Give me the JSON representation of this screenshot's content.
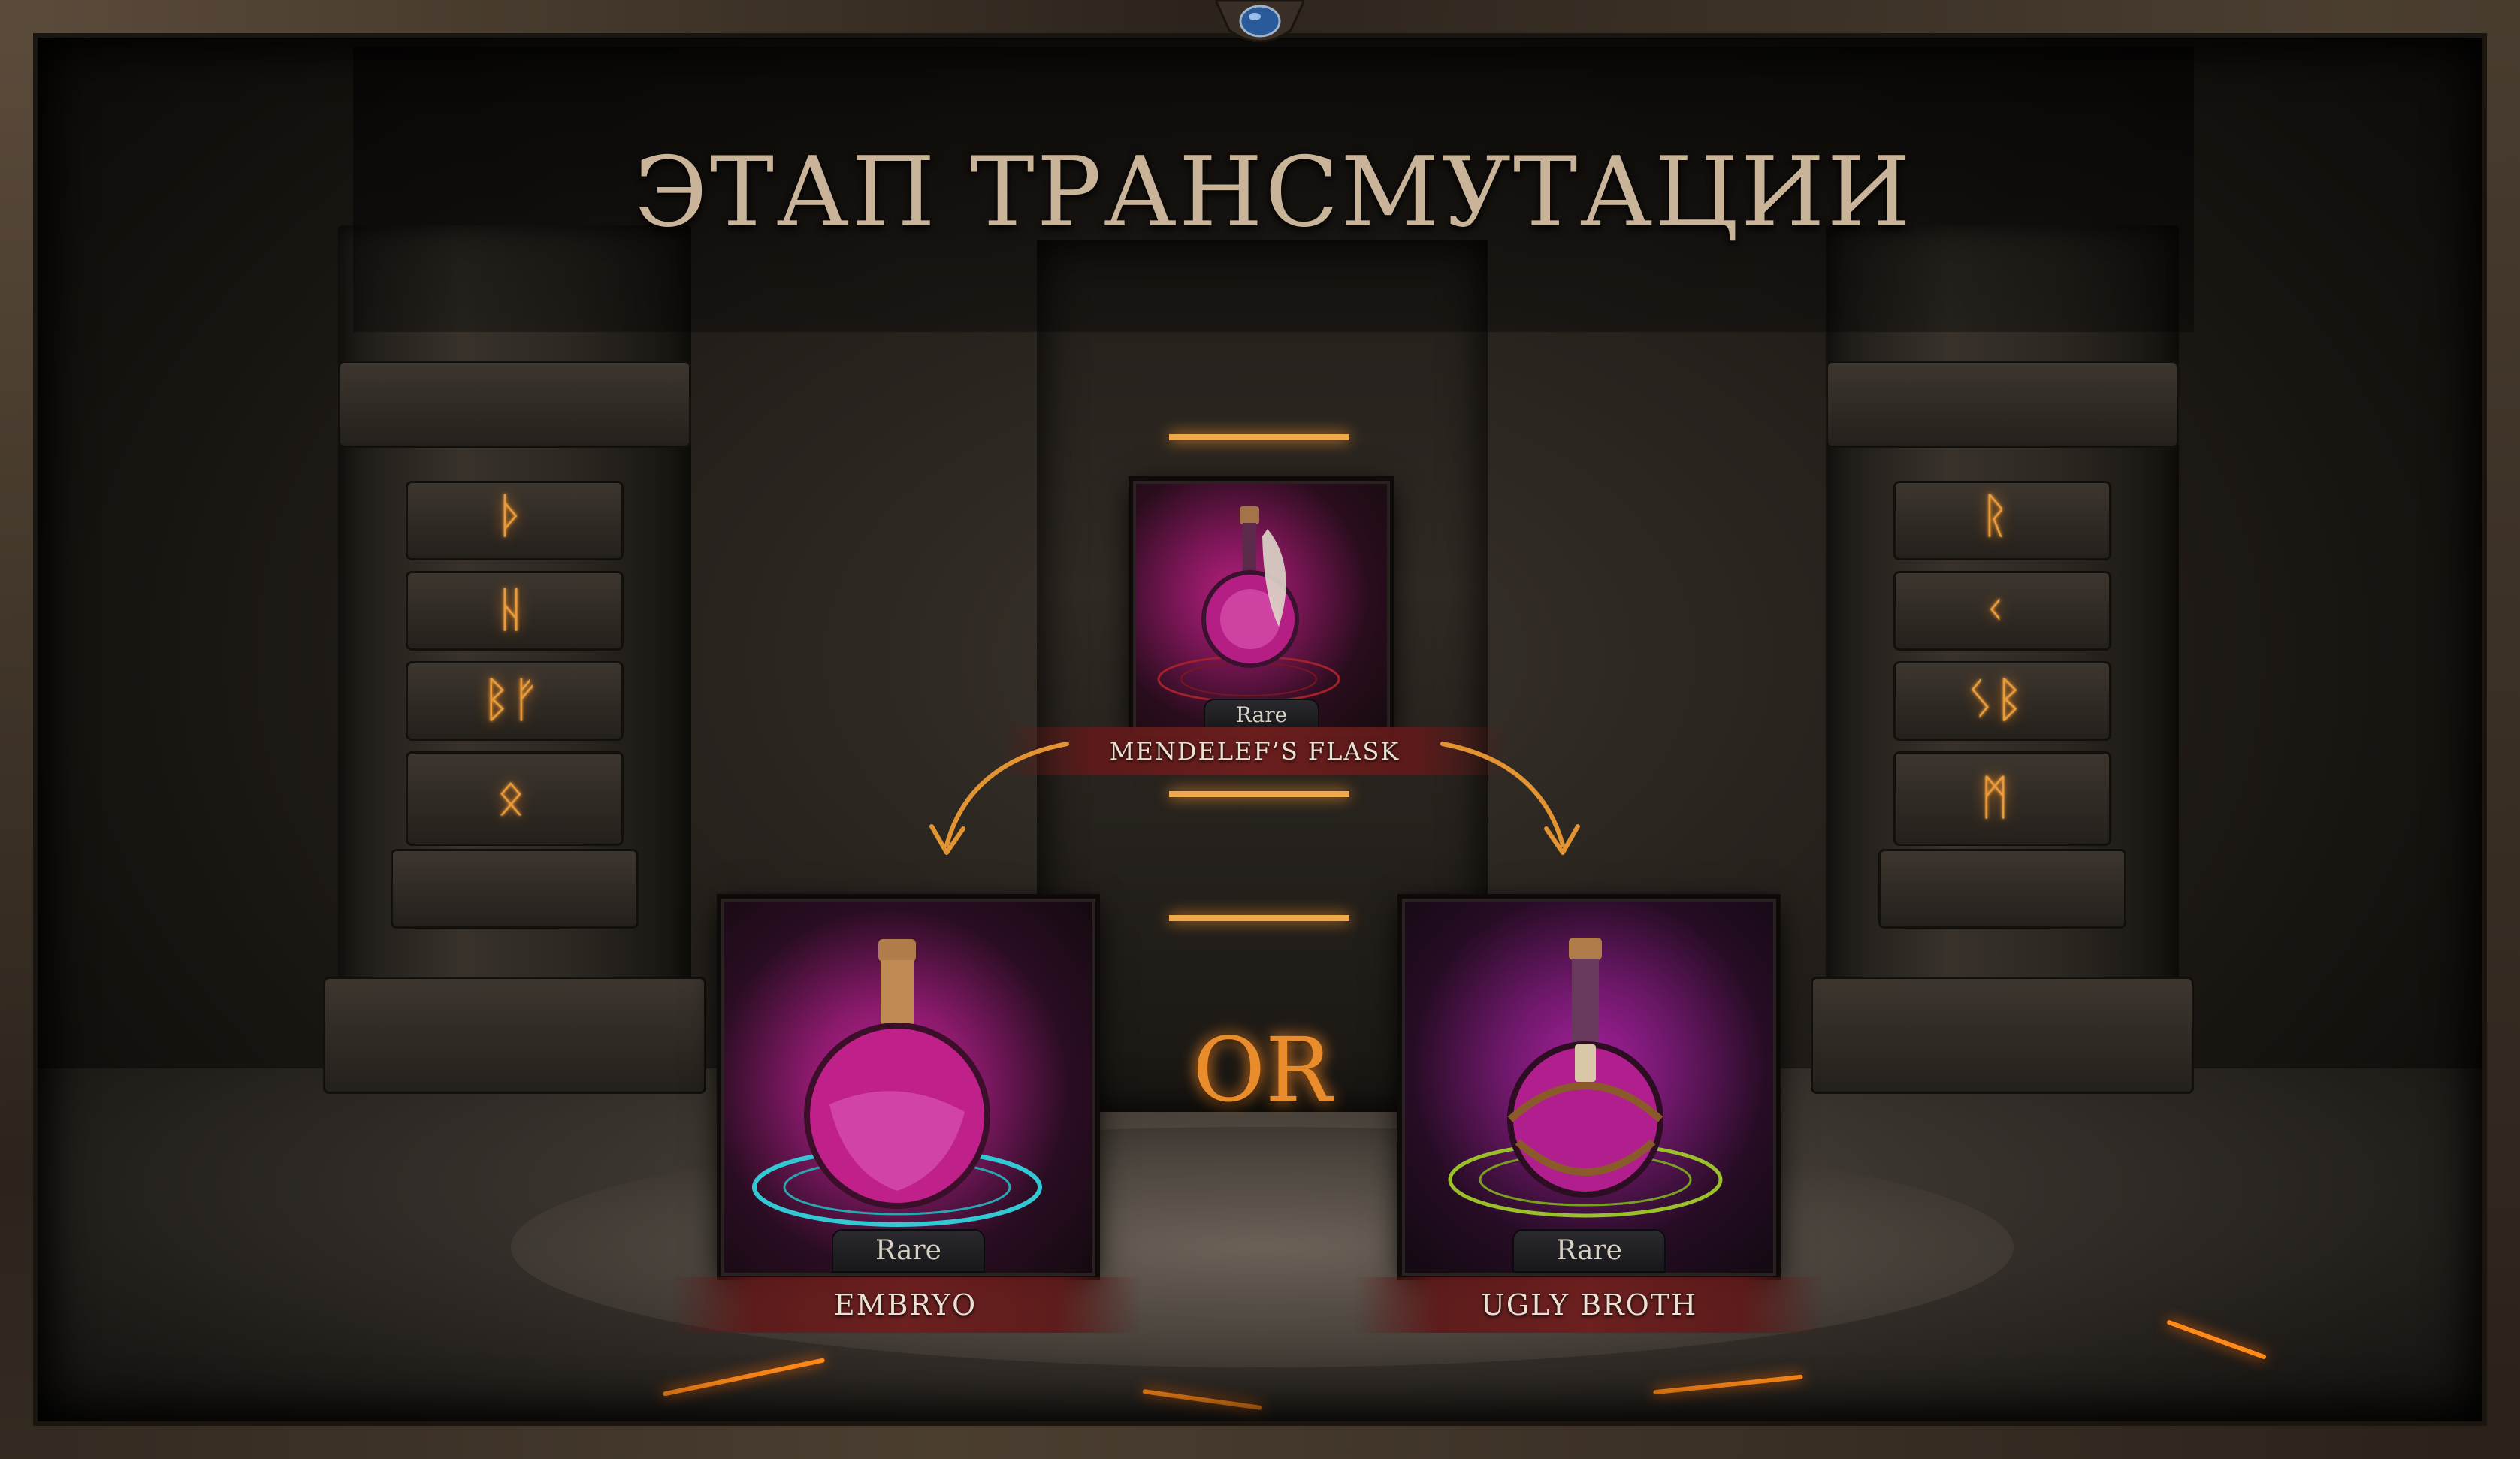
{
  "screen": {
    "title": "ЭТАП ТРАНСМУТАЦИИ",
    "or_label": "OR"
  },
  "runes": {
    "left": [
      "ᚦ",
      "ᚺ",
      "ᛒᚠ",
      "ᛟ"
    ],
    "right": [
      "ᚱ",
      "ᚲ",
      "ᛊᛒ",
      "ᛗ"
    ]
  },
  "source_item": {
    "rarity": "Rare",
    "name": "MENDELEF’S FLASK"
  },
  "results": [
    {
      "rarity": "Rare",
      "name": "EMBRYO"
    },
    {
      "rarity": "Rare",
      "name": "UGLY BROTH"
    }
  ],
  "colors": {
    "title": "#c9b49a",
    "rune_glow": "#e99b3a",
    "potion_magenta": "#c0208a",
    "nameplate_red": "#6e1e1e",
    "or_orange": "#e98d2c"
  },
  "icons": {
    "top_gem": "blue-gem-icon",
    "arrows": "curved-arrow-icon"
  }
}
